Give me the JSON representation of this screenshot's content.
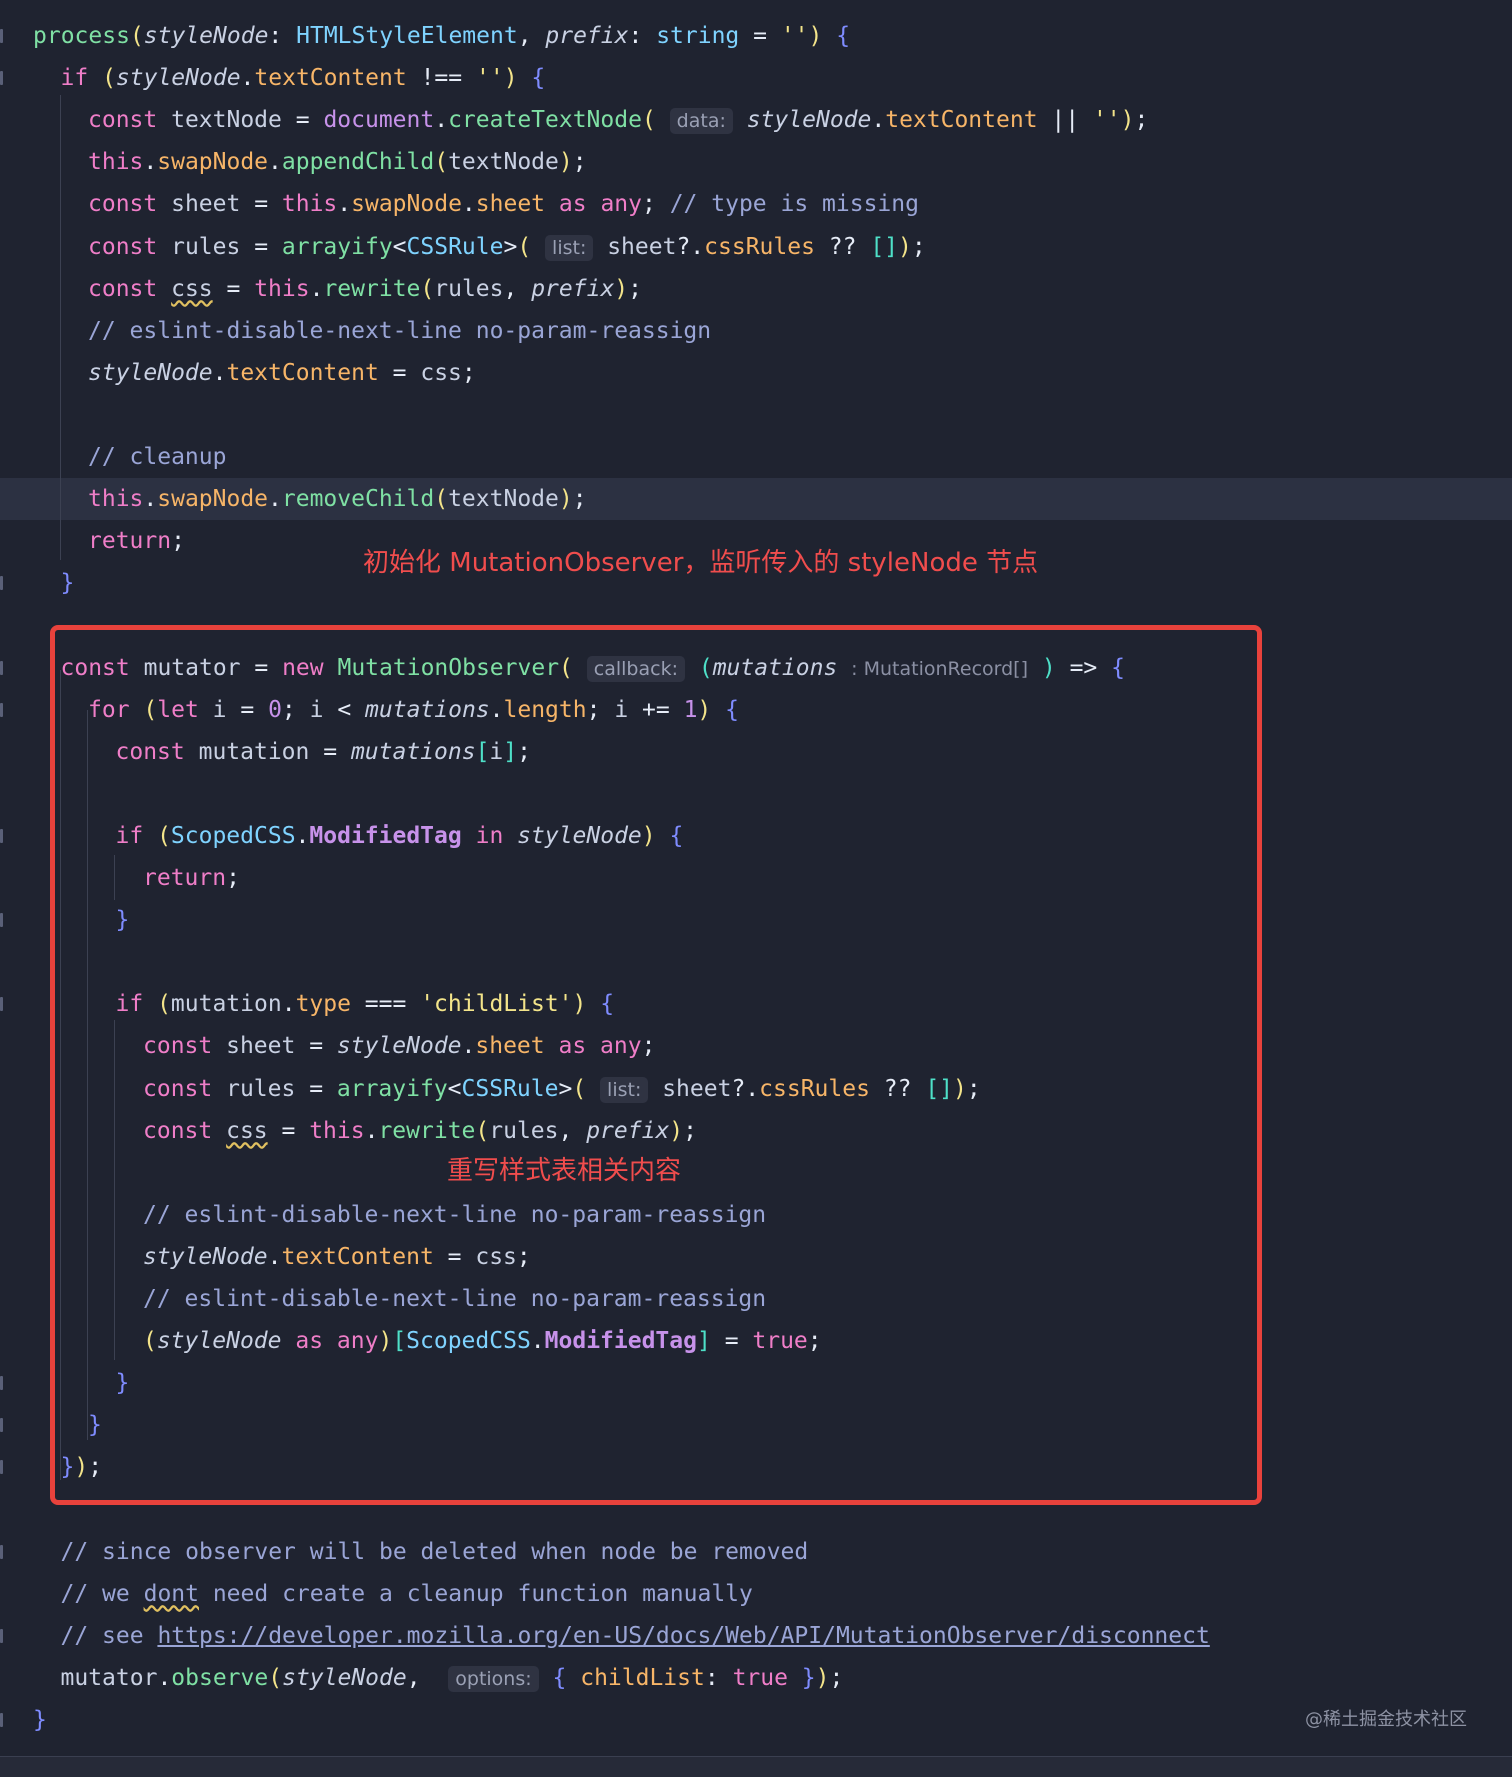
{
  "annotations": {
    "observer_note": "初始化 MutationObserver，监听传入的 styleNode 节点",
    "rewrite_note": "重写样式表相关内容"
  },
  "watermark": "@稀土掘金技术社区",
  "colors": {
    "background": "#1f2330",
    "highlight_box": "#e8423c",
    "annotation_text": "#f04d4d",
    "keyword": "#ef7ec8",
    "function": "#7fe0a4",
    "type": "#7fd3ff",
    "property": "#f7b568",
    "string": "#f3e48a",
    "comment": "#9aa5d6"
  },
  "code_lines": [
    "process(styleNode: HTMLStyleElement, prefix: string = '') {",
    "  if (styleNode.textContent !== '') {",
    "    const textNode = document.createTextNode( data: styleNode.textContent || '');",
    "    this.swapNode.appendChild(textNode);",
    "    const sheet = this.swapNode.sheet as any; // type is missing",
    "    const rules = arrayify<CSSRule>( list: sheet?.cssRules ?? []);",
    "    const css = this.rewrite(rules, prefix);",
    "    // eslint-disable-next-line no-param-reassign",
    "    styleNode.textContent = css;",
    "",
    "    // cleanup",
    "    this.swapNode.removeChild(textNode);",
    "    return;",
    "  }",
    "",
    "  const mutator = new MutationObserver( callback: (mutations : MutationRecord[] ) => {",
    "    for (let i = 0; i < mutations.length; i += 1) {",
    "      const mutation = mutations[i];",
    "",
    "      if (ScopedCSS.ModifiedTag in styleNode) {",
    "        return;",
    "      }",
    "",
    "      if (mutation.type === 'childList') {",
    "        const sheet = styleNode.sheet as any;",
    "        const rules = arrayify<CSSRule>( list: sheet?.cssRules ?? []);",
    "        const css = this.rewrite(rules, prefix);",
    "",
    "        // eslint-disable-next-line no-param-reassign",
    "        styleNode.textContent = css;",
    "        // eslint-disable-next-line no-param-reassign",
    "        (styleNode as any)[ScopedCSS.ModifiedTag] = true;",
    "      }",
    "    }",
    "  });",
    "",
    "  // since observer will be deleted when node be removed",
    "  // we dont need create a cleanup function manually",
    "  // see https://developer.mozilla.org/en-US/docs/Web/API/MutationObserver/disconnect",
    "  mutator.observe(styleNode,  options: { childList: true });",
    "}"
  ],
  "tokens": {
    "l0": [
      [
        "fn",
        "process"
      ],
      [
        "b1",
        "("
      ],
      [
        "pa",
        "styleNode"
      ],
      [
        "pu",
        ": "
      ],
      [
        "ty",
        "HTMLStyleElement"
      ],
      [
        "pu",
        ", "
      ],
      [
        "pa",
        "prefix"
      ],
      [
        "pu",
        ": "
      ],
      [
        "ty",
        "string"
      ],
      [
        "op",
        " = "
      ],
      [
        "st",
        "''"
      ],
      [
        "b1",
        ")"
      ],
      [
        "pu",
        " "
      ],
      [
        "b2",
        "{"
      ]
    ],
    "l1": [
      [
        "kw",
        "if"
      ],
      [
        "pu",
        " "
      ],
      [
        "b1",
        "("
      ],
      [
        "pa",
        "styleNode"
      ],
      [
        "pu",
        "."
      ],
      [
        "pr",
        "textContent"
      ],
      [
        "op",
        " !== "
      ],
      [
        "st",
        "''"
      ],
      [
        "b1",
        ")"
      ],
      [
        "pu",
        " "
      ],
      [
        "b2",
        "{"
      ]
    ],
    "l2": [
      [
        "kw",
        "const"
      ],
      [
        "va",
        " textNode "
      ],
      [
        "op",
        "= "
      ],
      [
        "kw2",
        "document"
      ],
      [
        "pu",
        "."
      ],
      [
        "fn",
        "createTextNode"
      ],
      [
        "b1",
        "("
      ],
      [
        "pu",
        " "
      ],
      [
        "hint",
        "data:"
      ],
      [
        "pu",
        " "
      ],
      [
        "pa",
        "styleNode"
      ],
      [
        "pu",
        "."
      ],
      [
        "pr",
        "textContent"
      ],
      [
        "op",
        " || "
      ],
      [
        "st",
        "''"
      ],
      [
        "b1",
        ")"
      ],
      [
        "pu",
        ";"
      ]
    ],
    "l3": [
      [
        "kw",
        "this"
      ],
      [
        "pu",
        "."
      ],
      [
        "pr",
        "swapNode"
      ],
      [
        "pu",
        "."
      ],
      [
        "fn",
        "appendChild"
      ],
      [
        "b1",
        "("
      ],
      [
        "va",
        "textNode"
      ],
      [
        "b1",
        ")"
      ],
      [
        "pu",
        ";"
      ]
    ],
    "l4": [
      [
        "kw",
        "const"
      ],
      [
        "va",
        " sheet "
      ],
      [
        "op",
        "= "
      ],
      [
        "kw",
        "this"
      ],
      [
        "pu",
        "."
      ],
      [
        "pr",
        "swapNode"
      ],
      [
        "pu",
        "."
      ],
      [
        "pr",
        "sheet"
      ],
      [
        "pu",
        " "
      ],
      [
        "kw",
        "as"
      ],
      [
        "pu",
        " "
      ],
      [
        "kw",
        "any"
      ],
      [
        "pu",
        ";"
      ],
      [
        "cm",
        " // type is missing"
      ]
    ],
    "l5": [
      [
        "kw",
        "const"
      ],
      [
        "va",
        " rules "
      ],
      [
        "op",
        "= "
      ],
      [
        "fn",
        "arrayify"
      ],
      [
        "op",
        "<"
      ],
      [
        "ty",
        "CSSRule"
      ],
      [
        "op",
        ">"
      ],
      [
        "b1",
        "("
      ],
      [
        "pu",
        " "
      ],
      [
        "hint",
        "list:"
      ],
      [
        "va",
        " sheet"
      ],
      [
        "op",
        "?."
      ],
      [
        "pr",
        "cssRules"
      ],
      [
        "op",
        " ?? "
      ],
      [
        "b3",
        "[]"
      ],
      [
        "b1",
        ")"
      ],
      [
        "pu",
        ";"
      ]
    ],
    "l6": [
      [
        "kw",
        "const"
      ],
      [
        "pu",
        " "
      ],
      [
        "squig",
        "css"
      ],
      [
        "op",
        " = "
      ],
      [
        "kw",
        "this"
      ],
      [
        "pu",
        "."
      ],
      [
        "fn",
        "rewrite"
      ],
      [
        "b1",
        "("
      ],
      [
        "va",
        "rules"
      ],
      [
        "pu",
        ", "
      ],
      [
        "pa",
        "prefix"
      ],
      [
        "b1",
        ")"
      ],
      [
        "pu",
        ";"
      ]
    ],
    "l7": [
      [
        "cm",
        "// eslint-disable-next-line no-param-reassign"
      ]
    ],
    "l8": [
      [
        "pa",
        "styleNode"
      ],
      [
        "pu",
        "."
      ],
      [
        "pr",
        "textContent"
      ],
      [
        "op",
        " = "
      ],
      [
        "va",
        "css"
      ],
      [
        "pu",
        ";"
      ]
    ],
    "l10": [
      [
        "cm",
        "// cleanup"
      ]
    ],
    "l11": [
      [
        "kw",
        "this"
      ],
      [
        "pu",
        "."
      ],
      [
        "pr",
        "swapNode"
      ],
      [
        "pu",
        "."
      ],
      [
        "fn",
        "removeChild"
      ],
      [
        "b1",
        "("
      ],
      [
        "va",
        "textNode"
      ],
      [
        "b1",
        ")"
      ],
      [
        "pu",
        ";"
      ]
    ],
    "l12": [
      [
        "kw",
        "return"
      ],
      [
        "pu",
        ";"
      ]
    ],
    "l13": [
      [
        "b2",
        "}"
      ]
    ],
    "l15": [
      [
        "kw",
        "const"
      ],
      [
        "va",
        " mutator "
      ],
      [
        "op",
        "= "
      ],
      [
        "kw",
        "new"
      ],
      [
        "pu",
        " "
      ],
      [
        "fn",
        "MutationObserver"
      ],
      [
        "b1",
        "("
      ],
      [
        "pu",
        " "
      ],
      [
        "hint",
        "callback:"
      ],
      [
        "pu",
        " "
      ],
      [
        "b3",
        "("
      ],
      [
        "pa",
        "mutations"
      ],
      [
        "pu",
        " "
      ],
      [
        "hint-plain",
        ": MutationRecord[]"
      ],
      [
        "pu",
        " "
      ],
      [
        "b3",
        ")"
      ],
      [
        "op",
        " => "
      ],
      [
        "b2",
        "{"
      ]
    ],
    "l16": [
      [
        "kw",
        "for"
      ],
      [
        "pu",
        " "
      ],
      [
        "b1",
        "("
      ],
      [
        "kw",
        "let"
      ],
      [
        "va",
        " i "
      ],
      [
        "op",
        "= "
      ],
      [
        "nu",
        "0"
      ],
      [
        "pu",
        "; "
      ],
      [
        "va",
        "i "
      ],
      [
        "op",
        "< "
      ],
      [
        "pa",
        "mutations"
      ],
      [
        "pu",
        "."
      ],
      [
        "pr",
        "length"
      ],
      [
        "pu",
        "; "
      ],
      [
        "va",
        "i "
      ],
      [
        "op",
        "+= "
      ],
      [
        "nu",
        "1"
      ],
      [
        "b1",
        ")"
      ],
      [
        "pu",
        " "
      ],
      [
        "b2",
        "{"
      ]
    ],
    "l17": [
      [
        "kw",
        "const"
      ],
      [
        "va",
        " mutation "
      ],
      [
        "op",
        "= "
      ],
      [
        "pa",
        "mutations"
      ],
      [
        "b3",
        "["
      ],
      [
        "va",
        "i"
      ],
      [
        "b3",
        "]"
      ],
      [
        "pu",
        ";"
      ]
    ],
    "l19": [
      [
        "kw",
        "if"
      ],
      [
        "pu",
        " "
      ],
      [
        "b1",
        "("
      ],
      [
        "ty",
        "ScopedCSS"
      ],
      [
        "pu",
        "."
      ],
      [
        "kw2 bold",
        "ModifiedTag"
      ],
      [
        "pu",
        " "
      ],
      [
        "kw",
        "in"
      ],
      [
        "pu",
        " "
      ],
      [
        "pa",
        "styleNode"
      ],
      [
        "b1",
        ")"
      ],
      [
        "pu",
        " "
      ],
      [
        "b2",
        "{"
      ]
    ],
    "l20": [
      [
        "kw",
        "return"
      ],
      [
        "pu",
        ";"
      ]
    ],
    "l21": [
      [
        "b2",
        "}"
      ]
    ],
    "l23": [
      [
        "kw",
        "if"
      ],
      [
        "pu",
        " "
      ],
      [
        "b1",
        "("
      ],
      [
        "va",
        "mutation"
      ],
      [
        "pu",
        "."
      ],
      [
        "pr",
        "type"
      ],
      [
        "op",
        " === "
      ],
      [
        "st",
        "'childList'"
      ],
      [
        "b1",
        ")"
      ],
      [
        "pu",
        " "
      ],
      [
        "b2",
        "{"
      ]
    ],
    "l24": [
      [
        "kw",
        "const"
      ],
      [
        "va",
        " sheet "
      ],
      [
        "op",
        "= "
      ],
      [
        "pa",
        "styleNode"
      ],
      [
        "pu",
        "."
      ],
      [
        "pr",
        "sheet"
      ],
      [
        "pu",
        " "
      ],
      [
        "kw",
        "as"
      ],
      [
        "pu",
        " "
      ],
      [
        "kw",
        "any"
      ],
      [
        "pu",
        ";"
      ]
    ],
    "l25": [
      [
        "kw",
        "const"
      ],
      [
        "va",
        " rules "
      ],
      [
        "op",
        "= "
      ],
      [
        "fn",
        "arrayify"
      ],
      [
        "op",
        "<"
      ],
      [
        "ty",
        "CSSRule"
      ],
      [
        "op",
        ">"
      ],
      [
        "b1",
        "("
      ],
      [
        "pu",
        " "
      ],
      [
        "hint",
        "list:"
      ],
      [
        "va",
        " sheet"
      ],
      [
        "op",
        "?."
      ],
      [
        "pr",
        "cssRules"
      ],
      [
        "op",
        " ?? "
      ],
      [
        "b3",
        "[]"
      ],
      [
        "b1",
        ")"
      ],
      [
        "pu",
        ";"
      ]
    ],
    "l26": [
      [
        "kw",
        "const"
      ],
      [
        "pu",
        " "
      ],
      [
        "squig",
        "css"
      ],
      [
        "op",
        " = "
      ],
      [
        "kw",
        "this"
      ],
      [
        "pu",
        "."
      ],
      [
        "fn",
        "rewrite"
      ],
      [
        "b1",
        "("
      ],
      [
        "va",
        "rules"
      ],
      [
        "pu",
        ", "
      ],
      [
        "pa",
        "prefix"
      ],
      [
        "b1",
        ")"
      ],
      [
        "pu",
        ";"
      ]
    ],
    "l28": [
      [
        "cm",
        "// eslint-disable-next-line no-param-reassign"
      ]
    ],
    "l29": [
      [
        "pa",
        "styleNode"
      ],
      [
        "pu",
        "."
      ],
      [
        "pr",
        "textContent"
      ],
      [
        "op",
        " = "
      ],
      [
        "va",
        "css"
      ],
      [
        "pu",
        ";"
      ]
    ],
    "l30": [
      [
        "cm",
        "// eslint-disable-next-line no-param-reassign"
      ]
    ],
    "l31": [
      [
        "b1",
        "("
      ],
      [
        "pa",
        "styleNode"
      ],
      [
        "pu",
        " "
      ],
      [
        "kw",
        "as"
      ],
      [
        "pu",
        " "
      ],
      [
        "kw",
        "any"
      ],
      [
        "b1",
        ")"
      ],
      [
        "b3",
        "["
      ],
      [
        "ty",
        "ScopedCSS"
      ],
      [
        "pu",
        "."
      ],
      [
        "kw2 bold",
        "ModifiedTag"
      ],
      [
        "b3",
        "]"
      ],
      [
        "op",
        " = "
      ],
      [
        "kw",
        "true"
      ],
      [
        "pu",
        ";"
      ]
    ],
    "l32": [
      [
        "b2",
        "}"
      ]
    ],
    "l33": [
      [
        "b2",
        "}"
      ]
    ],
    "l34": [
      [
        "b2",
        "}"
      ],
      [
        "b1",
        ")"
      ],
      [
        "pu",
        ";"
      ]
    ],
    "l36": [
      [
        "cm",
        "// since observer will be deleted when node be removed"
      ]
    ],
    "l37": [
      [
        "cm",
        "// we "
      ],
      [
        "squig cm",
        "dont"
      ],
      [
        "cm",
        " need create a cleanup function manually"
      ]
    ],
    "l38": [
      [
        "cm",
        "// see "
      ],
      [
        "url",
        "https://developer.mozilla.org/en-US/docs/Web/API/MutationObserver/disconnect"
      ]
    ],
    "l39": [
      [
        "va",
        "mutator"
      ],
      [
        "pu",
        "."
      ],
      [
        "fn",
        "observe"
      ],
      [
        "b1",
        "("
      ],
      [
        "pa",
        "styleNode"
      ],
      [
        "pu",
        ",  "
      ],
      [
        "hint",
        "options:"
      ],
      [
        "pu",
        " "
      ],
      [
        "b2",
        "{"
      ],
      [
        "pr",
        " childList"
      ],
      [
        "pu",
        ": "
      ],
      [
        "kw",
        "true"
      ],
      [
        "b2",
        " }"
      ],
      [
        "b1",
        ")"
      ],
      [
        "pu",
        ";"
      ]
    ],
    "l40": [
      [
        "b2",
        "}"
      ]
    ]
  }
}
